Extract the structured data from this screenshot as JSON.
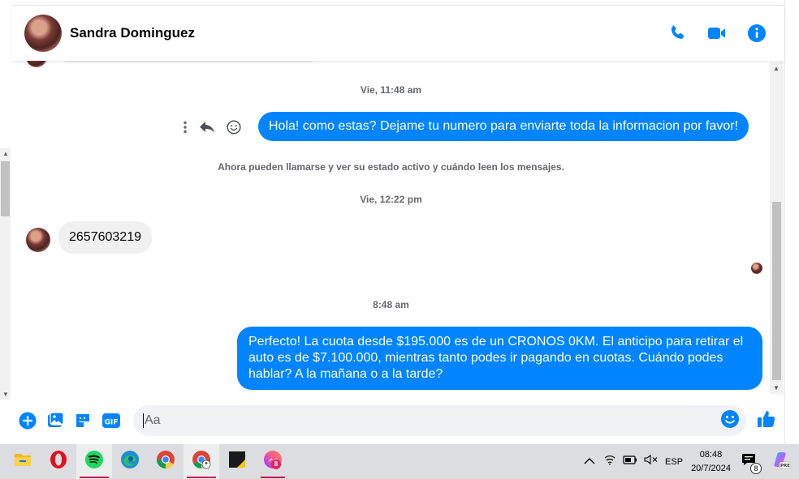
{
  "contact": {
    "name": "Sandra Dominguez"
  },
  "header_actions": [
    "phone-icon",
    "video-camera-icon",
    "info-icon"
  ],
  "colors": {
    "accent": "#0084ff",
    "incoming_bubble": "#f0f0f0",
    "meta_text": "#65676b",
    "taskbar": "#dcdde0"
  },
  "conversation": {
    "ts1": "Vie, 11:48 am",
    "msg1": "Hola! como estas? Dejame tu numero para enviarte toda la informacion por favor!",
    "system_note": "Ahora pueden llamarse y ver su estado activo y cuándo leen los mensajes.",
    "ts2": "Vie, 12:22 pm",
    "msg2": "2657603219",
    "ts3": "8:48 am",
    "msg3": "Perfecto! La cuota desde $195.000 es de un CRONOS 0KM. El anticipo para retirar el auto es de $7.100.000, mientras tanto podes ir pagando en cuotas. Cuándo podes hablar? A la mañana o a la tarde?"
  },
  "composer": {
    "placeholder": "Aa",
    "tools": [
      "plus-icon",
      "photo-icon",
      "sticker-icon",
      "gif-icon"
    ],
    "emoji": "emoji-icon",
    "like": "thumbs-up-icon"
  },
  "taskbar": {
    "apps": [
      "file-explorer",
      "opera",
      "spotify",
      "edge",
      "chrome",
      "chrome-profile",
      "sticky-notes",
      "messenger"
    ],
    "messenger_badge": "8",
    "language": "ESP",
    "time": "08:48",
    "date": "20/7/2024",
    "notifications_count": "8"
  }
}
